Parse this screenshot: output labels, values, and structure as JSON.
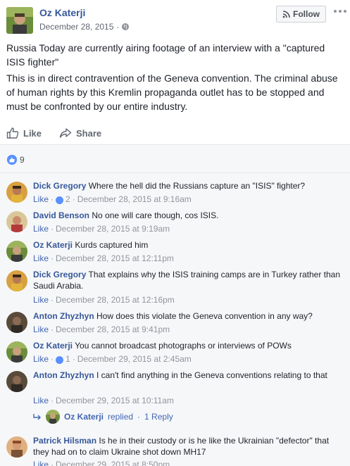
{
  "post": {
    "author": "Oz Katerji",
    "date": "December 28, 2015",
    "date_separator": "·",
    "follow_label": "Follow",
    "paragraph1": "Russia Today are currently airing footage of an interview with a \"captured ISIS fighter\"",
    "paragraph2": "This is in direct contravention of the Geneva convention. The criminal abuse of human rights by this Kremlin propaganda outlet has to be stopped and must be confronted by our entire industry."
  },
  "actions": {
    "like_label": "Like",
    "share_label": "Share"
  },
  "reactions": {
    "count": "9"
  },
  "comments": [
    {
      "name": "Dick Gregory",
      "text": "Where the hell did the Russians capture an \"ISIS\" fighter?",
      "like_label": "Like",
      "likes": "2",
      "time": "December 28, 2015 at 9:16am"
    },
    {
      "name": "David Benson",
      "text": "No one will care though, cos ISIS.",
      "like_label": "Like",
      "likes": "",
      "time": "December 28, 2015 at 9:19am"
    },
    {
      "name": "Oz Katerji",
      "text": "Kurds captured him",
      "like_label": "Like",
      "likes": "",
      "time": "December 28, 2015 at 12:11pm"
    },
    {
      "name": "Dick Gregory",
      "text": "That explains why the ISIS training camps are in Turkey rather than Saudi Arabia.",
      "like_label": "Like",
      "likes": "",
      "time": "December 28, 2015 at 12:16pm"
    },
    {
      "name": "Anton Zhyzhyn",
      "text": "How does this violate the Geneva convention in any way?",
      "like_label": "Like",
      "likes": "",
      "time": "December 28, 2015 at 9:41pm"
    },
    {
      "name": "Oz Katerji",
      "text": "You cannot broadcast photographs or interviews of POWs",
      "like_label": "Like",
      "likes": "1",
      "time": "December 29, 2015 at 2:45am"
    },
    {
      "name": "Anton Zhyzhyn",
      "text": "I can't find anything in the Geneva conventions relating to that",
      "like_label": "Like",
      "likes": "",
      "time": "December 29, 2015 at 10:11am"
    },
    {
      "name": "Patrick Hilsman",
      "text": "Is he in their custody or is he like the Ukrainian \"defector\" that they had on to claim Ukraine shot down MH17",
      "like_label": "Like",
      "likes": "",
      "time": "December 29, 2015 at 8:50pm"
    }
  ],
  "reply": {
    "name": "Oz Katerji",
    "text": "replied",
    "count_label": "1 Reply"
  },
  "meta_separator": "·",
  "colors": {
    "link": "#365899",
    "action_blue": "#4267b2",
    "like_badge": "#5890ff",
    "meta": "#90949c",
    "comments_bg": "#f6f7f9"
  },
  "icons": [
    "rss-follow-icon",
    "globe-icon",
    "more-dots-icon",
    "thumbs-up-icon",
    "share-arrow-icon",
    "like-reaction-icon",
    "reply-arrow-icon"
  ]
}
